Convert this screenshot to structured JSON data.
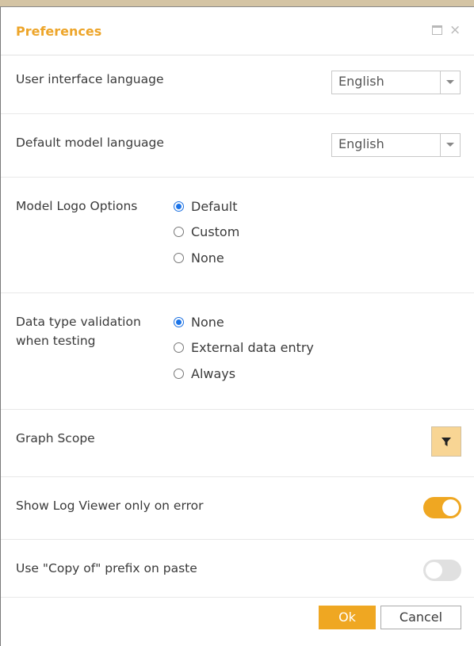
{
  "dialog": {
    "title": "Preferences",
    "maximize_icon": "window-maximize-icon",
    "close_icon": "close-icon",
    "close_glyph": "×"
  },
  "ui_language": {
    "label": "User interface language",
    "value": "English"
  },
  "model_language": {
    "label": "Default model language",
    "value": "English"
  },
  "logo_options": {
    "label": "Model Logo Options",
    "options": [
      "Default",
      "Custom",
      "None"
    ],
    "selected": "Default"
  },
  "validation": {
    "label_line1": "Data type validation",
    "label_line2": "when testing",
    "options": [
      "None",
      "External data entry",
      "Always"
    ],
    "selected": "None"
  },
  "graph_scope": {
    "label": "Graph Scope",
    "icon": "filter-icon"
  },
  "log_viewer": {
    "label": "Show Log Viewer only on error",
    "enabled": true
  },
  "copy_prefix": {
    "label": "Use \"Copy of\" prefix on paste",
    "enabled": false
  },
  "footer": {
    "ok_label": "Ok",
    "cancel_label": "Cancel"
  },
  "colors": {
    "accent": "#efa722",
    "title": "#eda52a",
    "radio_selected": "#1a73e8",
    "filter_bg": "#f8d594"
  }
}
